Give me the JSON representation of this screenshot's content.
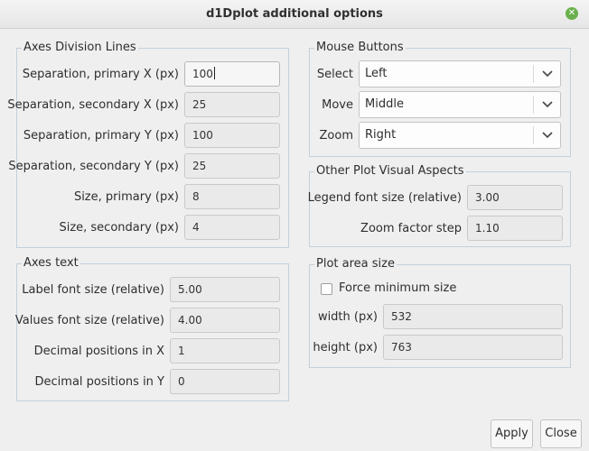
{
  "window": {
    "title": "d1Dplot additional options"
  },
  "axes_division": {
    "legend": "Axes Division Lines",
    "rows": [
      {
        "label": "Separation, primary X (px)",
        "value": "100"
      },
      {
        "label": "Separation, secondary X (px)",
        "value": "25"
      },
      {
        "label": "Separation, primary Y (px)",
        "value": "100"
      },
      {
        "label": "Separation, secondary Y (px)",
        "value": "25"
      },
      {
        "label": "Size, primary (px)",
        "value": "8"
      },
      {
        "label": "Size, secondary (px)",
        "value": "4"
      }
    ]
  },
  "axes_text": {
    "legend": "Axes text",
    "rows": [
      {
        "label": "Label font size (relative)",
        "value": "5.00"
      },
      {
        "label": "Values font size (relative)",
        "value": "4.00"
      },
      {
        "label": "Decimal positions in X",
        "value": "1"
      },
      {
        "label": "Decimal positions in Y",
        "value": "0"
      }
    ]
  },
  "mouse_buttons": {
    "legend": "Mouse Buttons",
    "rows": [
      {
        "label": "Select",
        "value": "Left"
      },
      {
        "label": "Move",
        "value": "Middle"
      },
      {
        "label": "Zoom",
        "value": "Right"
      }
    ]
  },
  "visual_aspects": {
    "legend": "Other Plot Visual Aspects",
    "rows": [
      {
        "label": "Legend font size (relative)",
        "value": "3.00"
      },
      {
        "label": "Zoom factor step",
        "value": "1.10"
      }
    ]
  },
  "plot_area": {
    "legend": "Plot area size",
    "force_label": "Force minimum size",
    "force_checked": false,
    "rows": [
      {
        "label": "width (px)",
        "value": "532"
      },
      {
        "label": "height (px)",
        "value": "763"
      }
    ]
  },
  "buttons": {
    "apply": "Apply",
    "close": "Close"
  },
  "icons": {
    "close": "close-icon",
    "dropdown": "chevron-down-icon"
  },
  "colors": {
    "close_icon_bg": "#6ab04c",
    "group_border": "#c2d0dc"
  }
}
